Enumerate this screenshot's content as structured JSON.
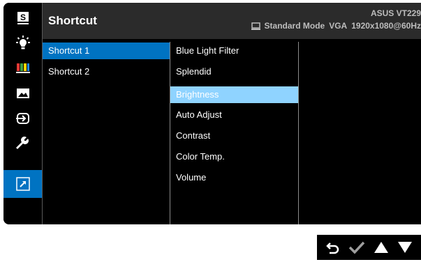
{
  "header": {
    "title": "Shortcut",
    "model": "ASUS VT229",
    "status_mode": "Standard Mode",
    "status_input": "VGA",
    "status_resolution": "1920x1080@60Hz"
  },
  "sidebar": {
    "icons": [
      "s-icon",
      "brightness-icon",
      "color-icon",
      "image-icon",
      "input-select-icon",
      "wrench-icon",
      "shortcut-icon"
    ],
    "active_index": 6
  },
  "menu": {
    "level1": [
      {
        "label": "Shortcut 1",
        "selected": true
      },
      {
        "label": "Shortcut 2",
        "selected": false
      }
    ],
    "level2": [
      {
        "label": "Blue Light Filter"
      },
      {
        "label": "Splendid"
      },
      {
        "label": "Brightness",
        "highlighted": true
      },
      {
        "label": "Auto Adjust"
      },
      {
        "label": "Contrast"
      },
      {
        "label": "Color Temp."
      },
      {
        "label": "Volume"
      }
    ]
  },
  "controls": {
    "icons": [
      "back-icon",
      "confirm-check-icon",
      "up-arrow-icon",
      "down-arrow-icon"
    ]
  },
  "colors": {
    "accent": "#0073c2",
    "highlight": "#8fd3ff",
    "osd_background": "#000000",
    "header_background": "#2b2b2b"
  }
}
